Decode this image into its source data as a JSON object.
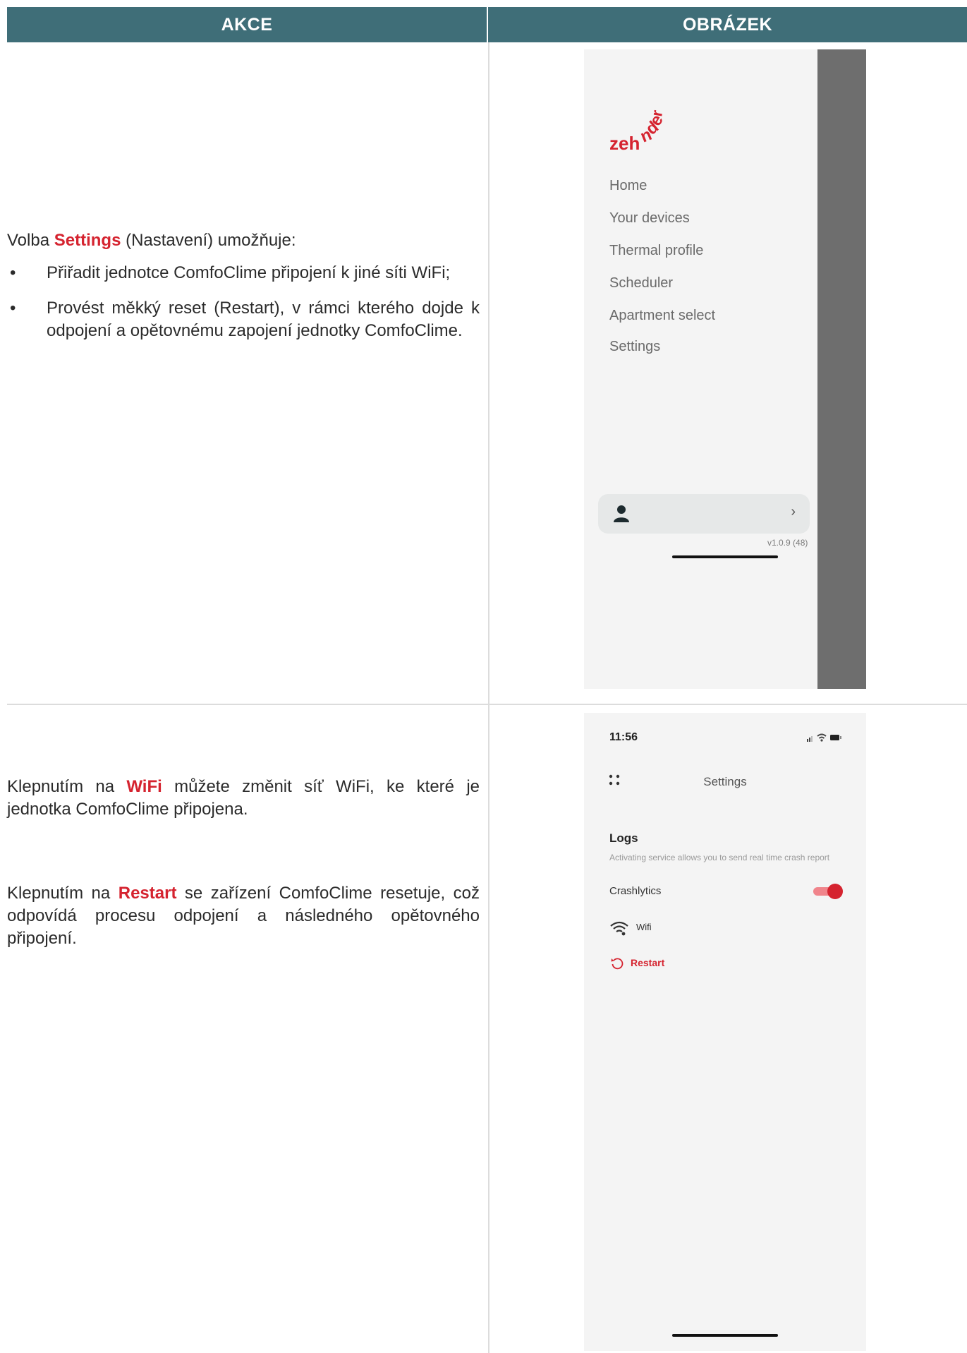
{
  "header": {
    "col_left": "AKCE",
    "col_right": "OBRÁZEK"
  },
  "row1": {
    "intro_prefix": "Volba ",
    "intro_accent": "Settings",
    "intro_suffix": " (Nastavení) umožňuje:",
    "bullets": [
      "Přiřadit jednotce ComfoClime připojení k jiné síti WiFi;",
      "Provést měkký reset (Restart), v rámci kterého dojde k odpojení a opětovnému zapojení jednotky ComfoClime."
    ]
  },
  "row2": {
    "p1_prefix": "Klepnutím na ",
    "p1_accent": "WiFi",
    "p1_suffix": " můžete změnit síť WiFi, ke které je jednotka ComfoClime připojena.",
    "p2_prefix": "Klepnutím na ",
    "p2_accent": "Restart",
    "p2_suffix": " se zařízení ComfoClime resetuje, což odpovídá procesu odpojení a následného opětovného připojení."
  },
  "phone_menu": {
    "logo_text": "zehnder",
    "items": [
      "Home",
      "Your devices",
      "Thermal profile",
      "Scheduler",
      "Apartment select",
      "Settings"
    ],
    "version": "v1.0.9 (48)"
  },
  "phone_settings": {
    "time": "11:56",
    "title": "Settings",
    "logs_title": "Logs",
    "logs_desc": "Activating service allows you to send real time crash report",
    "crashlytics_label": "Crashlytics",
    "crashlytics_on": true,
    "wifi_label": "Wifi",
    "restart_label": "Restart"
  },
  "colors": {
    "header_bg": "#3f6e78",
    "accent": "#d5232f",
    "overlay": "#6e6e6e"
  }
}
